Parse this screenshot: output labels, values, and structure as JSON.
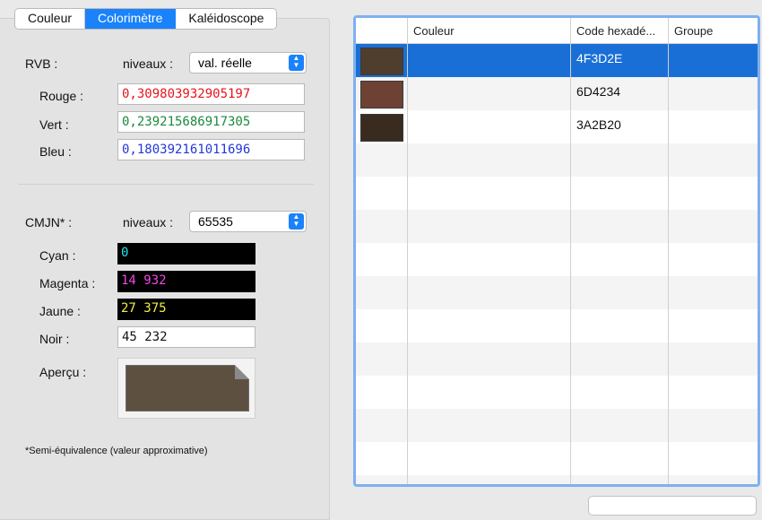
{
  "tabs": [
    "Couleur",
    "Colorimètre",
    "Kaléidoscope"
  ],
  "rgb": {
    "section_label": "RVB :",
    "levels_label": "niveaux :",
    "levels_value": "val. réelle",
    "rouge_label": "Rouge :",
    "rouge_value": "0,309803932905197",
    "vert_label": "Vert :",
    "vert_value": "0,239215686917305",
    "bleu_label": "Bleu :",
    "bleu_value": "0,180392161011696",
    "colors": {
      "rouge": "#e8141c",
      "vert": "#1a8a3e",
      "bleu": "#2338d8"
    }
  },
  "cmyk": {
    "section_label": "CMJN* :",
    "levels_label": "niveaux :",
    "levels_value": "65535",
    "cyan_label": "Cyan :",
    "cyan_value": "0",
    "magenta_label": "Magenta :",
    "magenta_value": "14 932",
    "jaune_label": "Jaune :",
    "jaune_value": "27 375",
    "noir_label": "Noir :",
    "noir_value": "45 232",
    "colors": {
      "cyan": "#22e6f0",
      "magenta": "#f046e6",
      "jaune": "#f2f03a"
    }
  },
  "preview": {
    "label": "Aperçu :",
    "color": "#5e5040"
  },
  "footnote": "*Semi-équivalence (valeur approximative)",
  "table": {
    "headers": [
      "",
      "Couleur",
      "Code hexadé...",
      "Groupe"
    ],
    "rows": [
      {
        "swatch": "#4f3d2e",
        "name": "",
        "hex": "4F3D2E",
        "group": "",
        "selected": true
      },
      {
        "swatch": "#6d4234",
        "name": "",
        "hex": "6D4234",
        "group": "",
        "selected": false
      },
      {
        "swatch": "#3a2b20",
        "name": "",
        "hex": "3A2B20",
        "group": "",
        "selected": false
      }
    ]
  }
}
